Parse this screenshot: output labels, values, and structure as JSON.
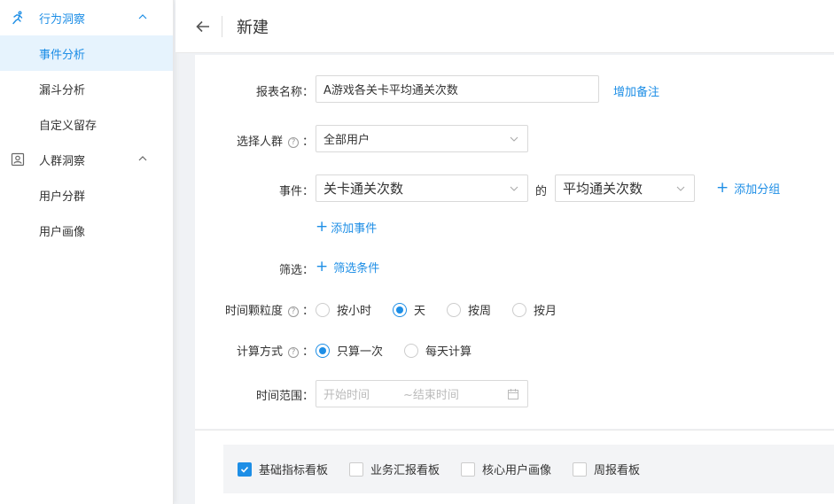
{
  "sidebar": {
    "groups": [
      {
        "label": "行为洞察",
        "icon": "running-person-icon",
        "expanded": true,
        "items": [
          {
            "label": "事件分析",
            "selected": true
          },
          {
            "label": "漏斗分析",
            "selected": false
          },
          {
            "label": "自定义留存",
            "selected": false
          }
        ]
      },
      {
        "label": "人群洞察",
        "icon": "person-card-icon",
        "expanded": true,
        "items": [
          {
            "label": "用户分群",
            "selected": false
          },
          {
            "label": "用户画像",
            "selected": false
          }
        ]
      }
    ]
  },
  "header": {
    "title": "新建"
  },
  "form": {
    "report_name": {
      "label": "报表名称：",
      "value": "A游戏各关卡平均通关次数",
      "add_note": "增加备注"
    },
    "audience": {
      "label": "选择人群",
      "colon": "：",
      "value": "全部用户"
    },
    "event": {
      "label": "事件：",
      "event_value": "关卡通关次数",
      "of": "的",
      "metric_value": "平均通关次数",
      "add_group": "添加分组",
      "add_event": "添加事件"
    },
    "filter": {
      "label": "筛选：",
      "add_filter": "筛选条件"
    },
    "granularity": {
      "label": "时间颗粒度",
      "colon": "：",
      "options": [
        "按小时",
        "天",
        "按周",
        "按月"
      ],
      "selected": 1
    },
    "calc": {
      "label": "计算方式",
      "colon": "：",
      "options": [
        "只算一次",
        "每天计算"
      ],
      "selected": 0
    },
    "time_range": {
      "label": "时间范围：",
      "start_placeholder": "开始时间",
      "end_placeholder": "~结束时间"
    }
  },
  "boards": [
    {
      "label": "基础指标看板",
      "checked": true
    },
    {
      "label": "业务汇报看板",
      "checked": false
    },
    {
      "label": "核心用户画像",
      "checked": false
    },
    {
      "label": "周报看板",
      "checked": false
    }
  ],
  "colors": {
    "accent": "#1d8ee6",
    "selected_bg": "#e6f3fd"
  }
}
